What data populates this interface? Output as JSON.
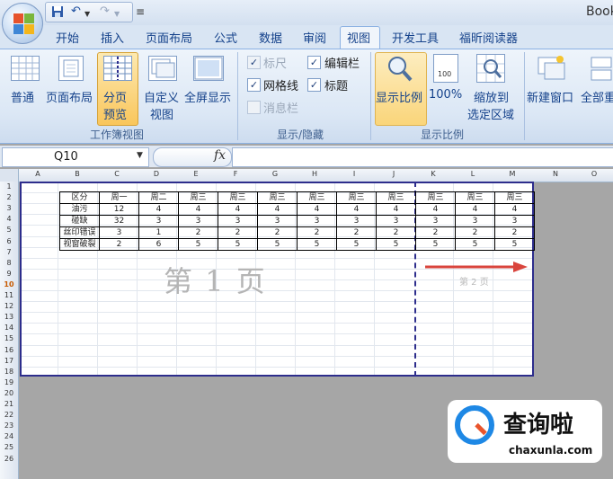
{
  "titlebar": {
    "workbook_title": "Book",
    "customize_icon": "≡"
  },
  "tabs": [
    {
      "label": "开始"
    },
    {
      "label": "插入"
    },
    {
      "label": "页面布局"
    },
    {
      "label": "公式"
    },
    {
      "label": "数据"
    },
    {
      "label": "审阅"
    },
    {
      "label": "视图",
      "active": true
    },
    {
      "label": "开发工具"
    },
    {
      "label": "福昕阅读器"
    }
  ],
  "ribbon": {
    "workbook_views": {
      "group_label": "工作簿视图",
      "normal": "普通",
      "page_layout": "页面布局",
      "page_break_l1": "分页",
      "page_break_l2": "预览",
      "custom_l1": "自定义",
      "custom_l2": "视图",
      "full_screen": "全屏显示"
    },
    "show_hide": {
      "group_label": "显示/隐藏",
      "ruler": "标尺",
      "formula_bar": "编辑栏",
      "gridlines": "网格线",
      "headings": "标题",
      "message_bar": "消息栏"
    },
    "zoom": {
      "group_label": "显示比例",
      "zoom_label": "显示比例",
      "hundred": "100%",
      "zoom_sel_l1": "缩放到",
      "zoom_sel_l2": "选定区域"
    },
    "window": {
      "new_window": "新建窗口",
      "arrange_all": "全部重"
    }
  },
  "formula_bar": {
    "name_box": "Q10",
    "fx": "fx",
    "formula": ""
  },
  "sheet": {
    "columns": [
      "A",
      "B",
      "C",
      "D",
      "E",
      "F",
      "G",
      "H",
      "I",
      "J",
      "K",
      "L",
      "M",
      "N",
      "O"
    ],
    "rows": [
      "1",
      "2",
      "3",
      "4",
      "5",
      "6",
      "7",
      "8",
      "9",
      "10",
      "11",
      "12",
      "13",
      "14",
      "15",
      "16",
      "17",
      "18",
      "19",
      "20",
      "21",
      "22",
      "23",
      "24",
      "25",
      "26"
    ],
    "selected_row": "10",
    "table": [
      [
        "区分",
        "周一",
        "周二",
        "周三",
        "周三",
        "周三",
        "周三",
        "周三",
        "周三",
        "周三",
        "周三",
        "周三"
      ],
      [
        "油污",
        "12",
        "4",
        "4",
        "4",
        "4",
        "4",
        "4",
        "4",
        "4",
        "4",
        "4"
      ],
      [
        "碰缺",
        "32",
        "3",
        "3",
        "3",
        "3",
        "3",
        "3",
        "3",
        "3",
        "3",
        "3"
      ],
      [
        "丝印错误",
        "3",
        "1",
        "2",
        "2",
        "2",
        "2",
        "2",
        "2",
        "2",
        "2",
        "2"
      ],
      [
        "视窗破裂",
        "2",
        "6",
        "5",
        "5",
        "5",
        "5",
        "5",
        "5",
        "5",
        "5",
        "5"
      ]
    ],
    "page1_label": "第 1 页",
    "page2_label": "第 2 页"
  },
  "watermark": {
    "brand": "查询啦",
    "domain": "chaxunla.com"
  },
  "colors": {
    "accent": "#15428b",
    "page_border": "#2d2d8c",
    "arrow": "#d9443c",
    "selected_button": "#f9c65c"
  }
}
